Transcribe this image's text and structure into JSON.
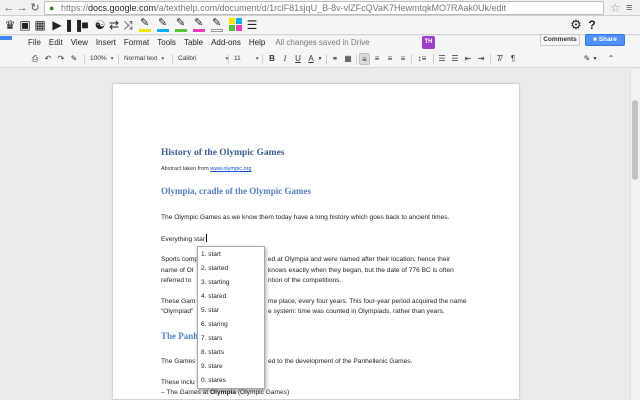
{
  "browser": {
    "url_prefix": "https://",
    "url_host": "docs.google.com",
    "url_path": "/a/texthelp.com/document/d/1rclF81sjqU_B-8v-vlZFcQVaK7HewmtqkMO7RAak0Uk/edit",
    "back_glyph": "←",
    "forward_glyph": "→",
    "reload_glyph": "↻",
    "menu_glyph": "≡",
    "star_glyph": "☆"
  },
  "extension_toolbar": {
    "highlight_colors": [
      "#f2e600",
      "#00aef0",
      "#5ac13c",
      "#ec3bbf"
    ],
    "gear_glyph": "⚙",
    "help_glyph": "?",
    "puzzle_label": "TH"
  },
  "docs": {
    "menu": [
      "File",
      "Edit",
      "View",
      "Insert",
      "Format",
      "Tools",
      "Table",
      "Add-ons",
      "Help"
    ],
    "save_status": "All changes saved in Drive",
    "comments_label": "Comments",
    "share_label": "Share",
    "toolbar": {
      "zoom": "100%",
      "style": "Normal text",
      "font": "Calibri",
      "size": "11",
      "bold": "B",
      "italic": "I",
      "underline": "U",
      "text_color": "A"
    }
  },
  "document": {
    "title": "History of the Olympic  Games",
    "abstract_prefix": "Abstract taken from ",
    "abstract_link": "www.olympic.org",
    "heading1": "Olympia, cradle of the Olympic Games",
    "p1": "The Olympic Games as we know them today have a long history which goes back to ancient times.",
    "typing_line": "Everything star",
    "p2_line1_left": "Sports comp",
    "p2_line1_right": "ed at Olympia and were named after their location, hence their",
    "p2_line2_left": "name of Ol",
    "p2_line2_right": "knows exactly when they began, but the date of 776 BC is often",
    "p2_line3_left": "referred to",
    "p2_line3_right": "ntion of the competitions.",
    "p3_line1_left": "These Gam",
    "p3_line1_right": "me place, every four years. This four-year period acquired the name",
    "p3_line2_left": "“Olympiad”",
    "p3_line2_right": "e system: time was counted in Olympiads, rather than years.",
    "heading2_partial": "The Panh",
    "p4_left": "The Games",
    "p4_right": "ed to the development of the Panhellenic Games.",
    "p5_left": "These inclu",
    "p6_prefix": "– The Games at ",
    "p6_bold": "Olympia",
    "p6_suffix": " (Olympic Games)"
  },
  "suggestions": [
    "1. start",
    "2. started",
    "3. starting",
    "4. stared",
    "5. star",
    "6. staring",
    "7. stars",
    "8. starts",
    "9. stare",
    "0. stares"
  ]
}
